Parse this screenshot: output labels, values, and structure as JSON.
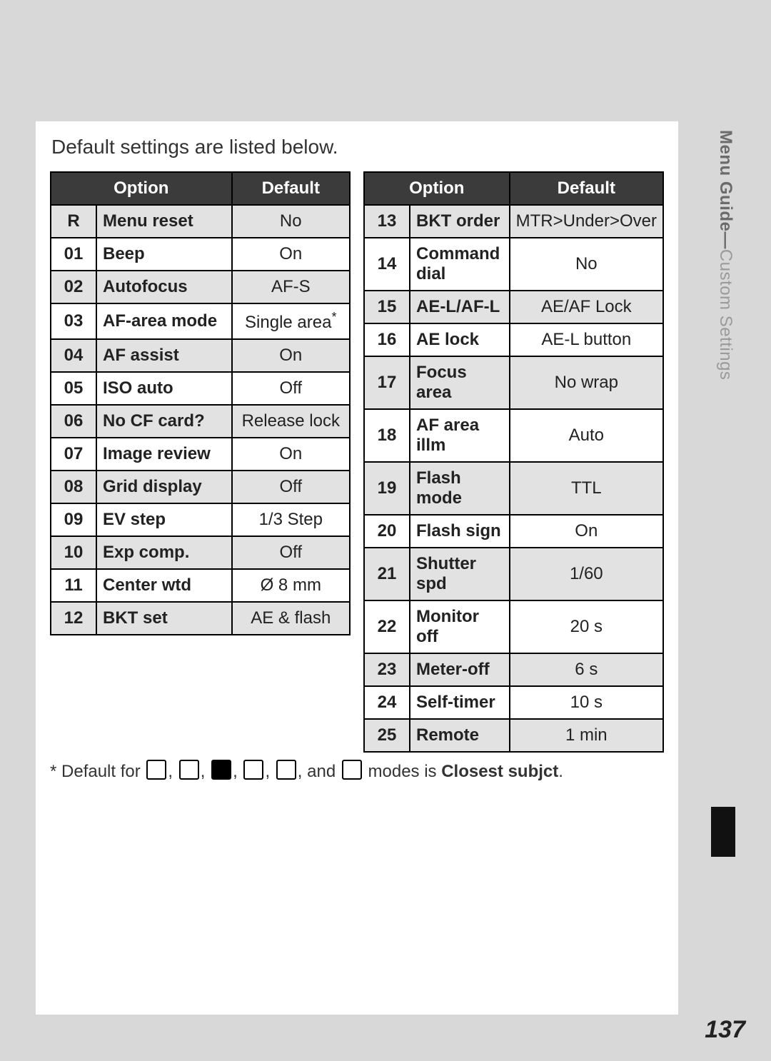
{
  "intro": "Default settings are listed below.",
  "header": {
    "option": "Option",
    "default": "Default"
  },
  "left_rows": [
    {
      "id": "R",
      "option": "Menu reset",
      "default": "No",
      "shade": true
    },
    {
      "id": "01",
      "option": "Beep",
      "default": "On",
      "shade": false
    },
    {
      "id": "02",
      "option": "Autofocus",
      "default": "AF-S",
      "shade": true
    },
    {
      "id": "03",
      "option": "AF-area mode",
      "default": "Single area *",
      "shade": false
    },
    {
      "id": "04",
      "option": "AF assist",
      "default": "On",
      "shade": true
    },
    {
      "id": "05",
      "option": "ISO auto",
      "default": "Off",
      "shade": false
    },
    {
      "id": "06",
      "option": "No CF card?",
      "default": "Release lock",
      "shade": true
    },
    {
      "id": "07",
      "option": "Image review",
      "default": "On",
      "shade": false
    },
    {
      "id": "08",
      "option": "Grid display",
      "default": "Off",
      "shade": true
    },
    {
      "id": "09",
      "option": "EV step",
      "default": "1/3 Step",
      "shade": false
    },
    {
      "id": "10",
      "option": "Exp comp.",
      "default": "Off",
      "shade": true
    },
    {
      "id": "11",
      "option": "Center wtd",
      "default": "Ø 8 mm",
      "shade": false
    },
    {
      "id": "12",
      "option": "BKT set",
      "default": "AE & flash",
      "shade": true
    }
  ],
  "right_rows": [
    {
      "id": "13",
      "option": "BKT order",
      "default": "MTR>Under>Over",
      "shade": true
    },
    {
      "id": "14",
      "option": "Command dial",
      "default": "No",
      "shade": false
    },
    {
      "id": "15",
      "option": "AE-L/AF-L",
      "default": "AE/AF Lock",
      "shade": true
    },
    {
      "id": "16",
      "option": "AE lock",
      "default": "AE-L button",
      "shade": false
    },
    {
      "id": "17",
      "option": "Focus area",
      "default": "No wrap",
      "shade": true
    },
    {
      "id": "18",
      "option": "AF area illm",
      "default": "Auto",
      "shade": false
    },
    {
      "id": "19",
      "option": "Flash mode",
      "default": "TTL",
      "shade": true
    },
    {
      "id": "20",
      "option": "Flash sign",
      "default": "On",
      "shade": false
    },
    {
      "id": "21",
      "option": "Shutter spd",
      "default": "1/60",
      "shade": true
    },
    {
      "id": "22",
      "option": "Monitor off",
      "default": "20 s",
      "shade": false
    },
    {
      "id": "23",
      "option": "Meter-off",
      "default": "6 s",
      "shade": true
    },
    {
      "id": "24",
      "option": "Self-timer",
      "default": "10 s",
      "shade": false
    },
    {
      "id": "25",
      "option": "Remote",
      "default": "1 min",
      "shade": true
    }
  ],
  "footnote": {
    "prefix": "* Default for ",
    "middle": " modes is ",
    "bold": "Closest subjct",
    "suffix": "."
  },
  "sidetab": {
    "main": "Menu Guide—",
    "light": "Custom Settings"
  },
  "page_number": "137"
}
